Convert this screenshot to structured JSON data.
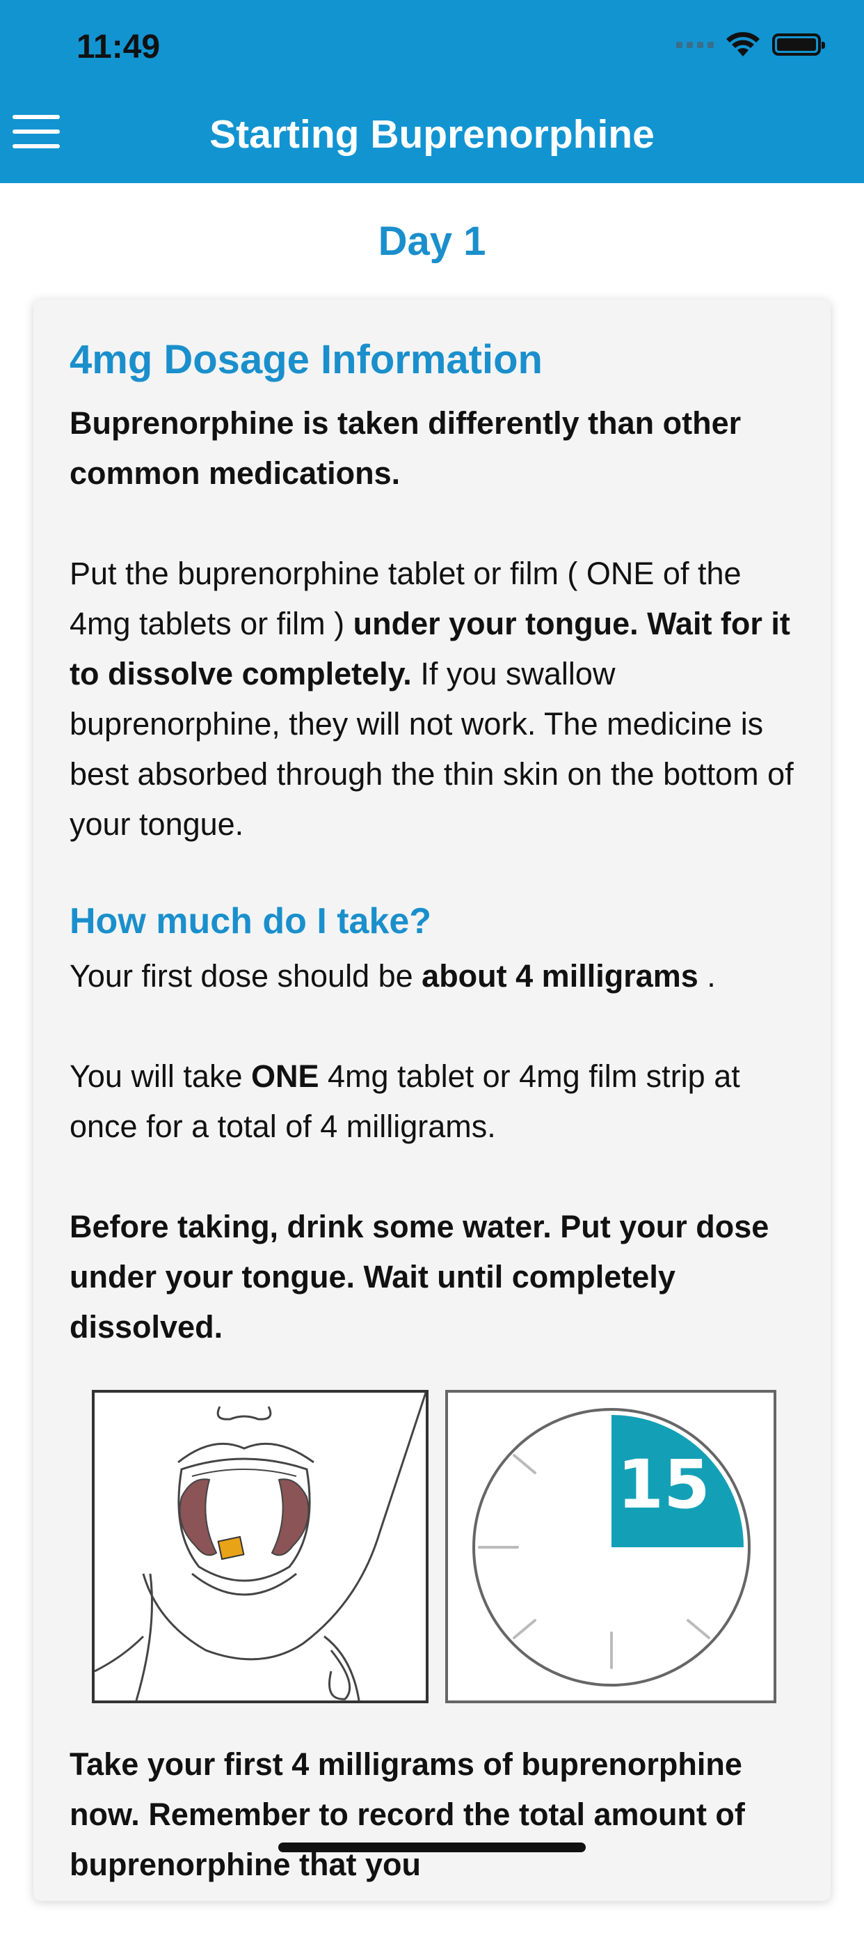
{
  "status_bar": {
    "time": "11:49",
    "icons": [
      "signal-icon",
      "wifi-icon",
      "battery-icon"
    ]
  },
  "header": {
    "title": "Starting Buprenorphine",
    "menu_icon": "hamburger-menu-icon",
    "background_color": "#1294d1"
  },
  "page": {
    "day_label": "Day 1",
    "section_title": "4mg Dosage Information",
    "intro_bold": "Buprenorphine is taken differently than other common medications.",
    "para1": {
      "t1": "Put the buprenorphine tablet or film ( ONE of the 4mg tablets or film ) ",
      "b1": "under your tongue. Wait for it to dissolve completely.",
      "t2": " If you swallow buprenorphine, they will not work. The medicine is best absorbed through the thin skin on the bottom of your tongue."
    },
    "how_much_title": "How much do I take?",
    "para2": {
      "t1": "Your first dose should be ",
      "b1": "about 4 milligrams",
      "t2": " ."
    },
    "para3": {
      "t1": "You will take ",
      "b1": "ONE",
      "t2": " 4mg tablet or 4mg film strip at once for a total of 4 milligrams."
    },
    "instructions_bold": "Before taking, drink some water. Put your dose under your tongue. Wait until completely dissolved.",
    "illustration_tongue_icon": "tablet-under-tongue-icon",
    "illustration_clock_icon": "timer-clock-icon",
    "clock_minutes": "15",
    "final_bold": "Take your first 4 milligrams of buprenorphine now.   Remember to record the total amount of buprenorphine that you"
  },
  "colors": {
    "accent": "#1a8fcc",
    "clock_teal": "#13a0b6",
    "tongue": "#8b5456",
    "tablet": "#e8a317"
  }
}
